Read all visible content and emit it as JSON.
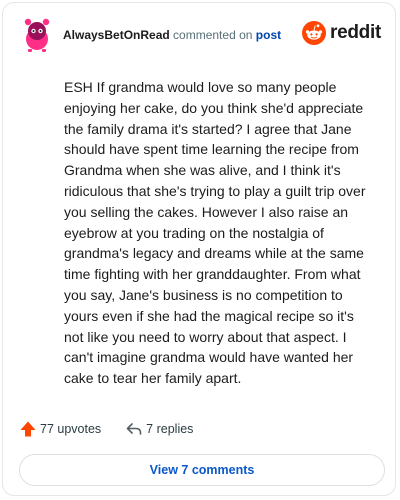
{
  "header": {
    "username": "AlwaysBetOnRead",
    "action_text": "commented on",
    "post_link": "post",
    "brand_name": "reddit",
    "avatar_icon": "snoo-avatar-icon",
    "brand_icon": "reddit-logo-icon",
    "colors": {
      "avatar_body": "#ff2e86",
      "avatar_head": "#9a0f5a",
      "brand_orange": "#ff4500"
    }
  },
  "comment": {
    "text": "ESH If grandma would love so many people enjoying her cake, do you think she'd appreciate the family drama it's started? I agree that Jane should have spent time learning the recipe from Grandma when she was alive, and I think it's ridiculous that she's trying to play a guilt trip over you selling the cakes. However I also raise an eyebrow at you trading on the nostalgia of grandma's legacy and dreams while at the same time fighting with her granddaughter. From what you say, Jane's business is no competition to yours even if she had the magical recipe so it's not like you need to worry about that aspect. I can't imagine grandma would have wanted her cake to tear her family apart."
  },
  "actions": {
    "upvotes_label": "77 upvotes",
    "replies_label": "7 replies",
    "upvote_icon": "upvote-arrow-icon",
    "reply_icon": "reply-arrow-icon",
    "upvote_color": "#ff4500"
  },
  "footer": {
    "view_comments_label": "View 7 comments"
  }
}
